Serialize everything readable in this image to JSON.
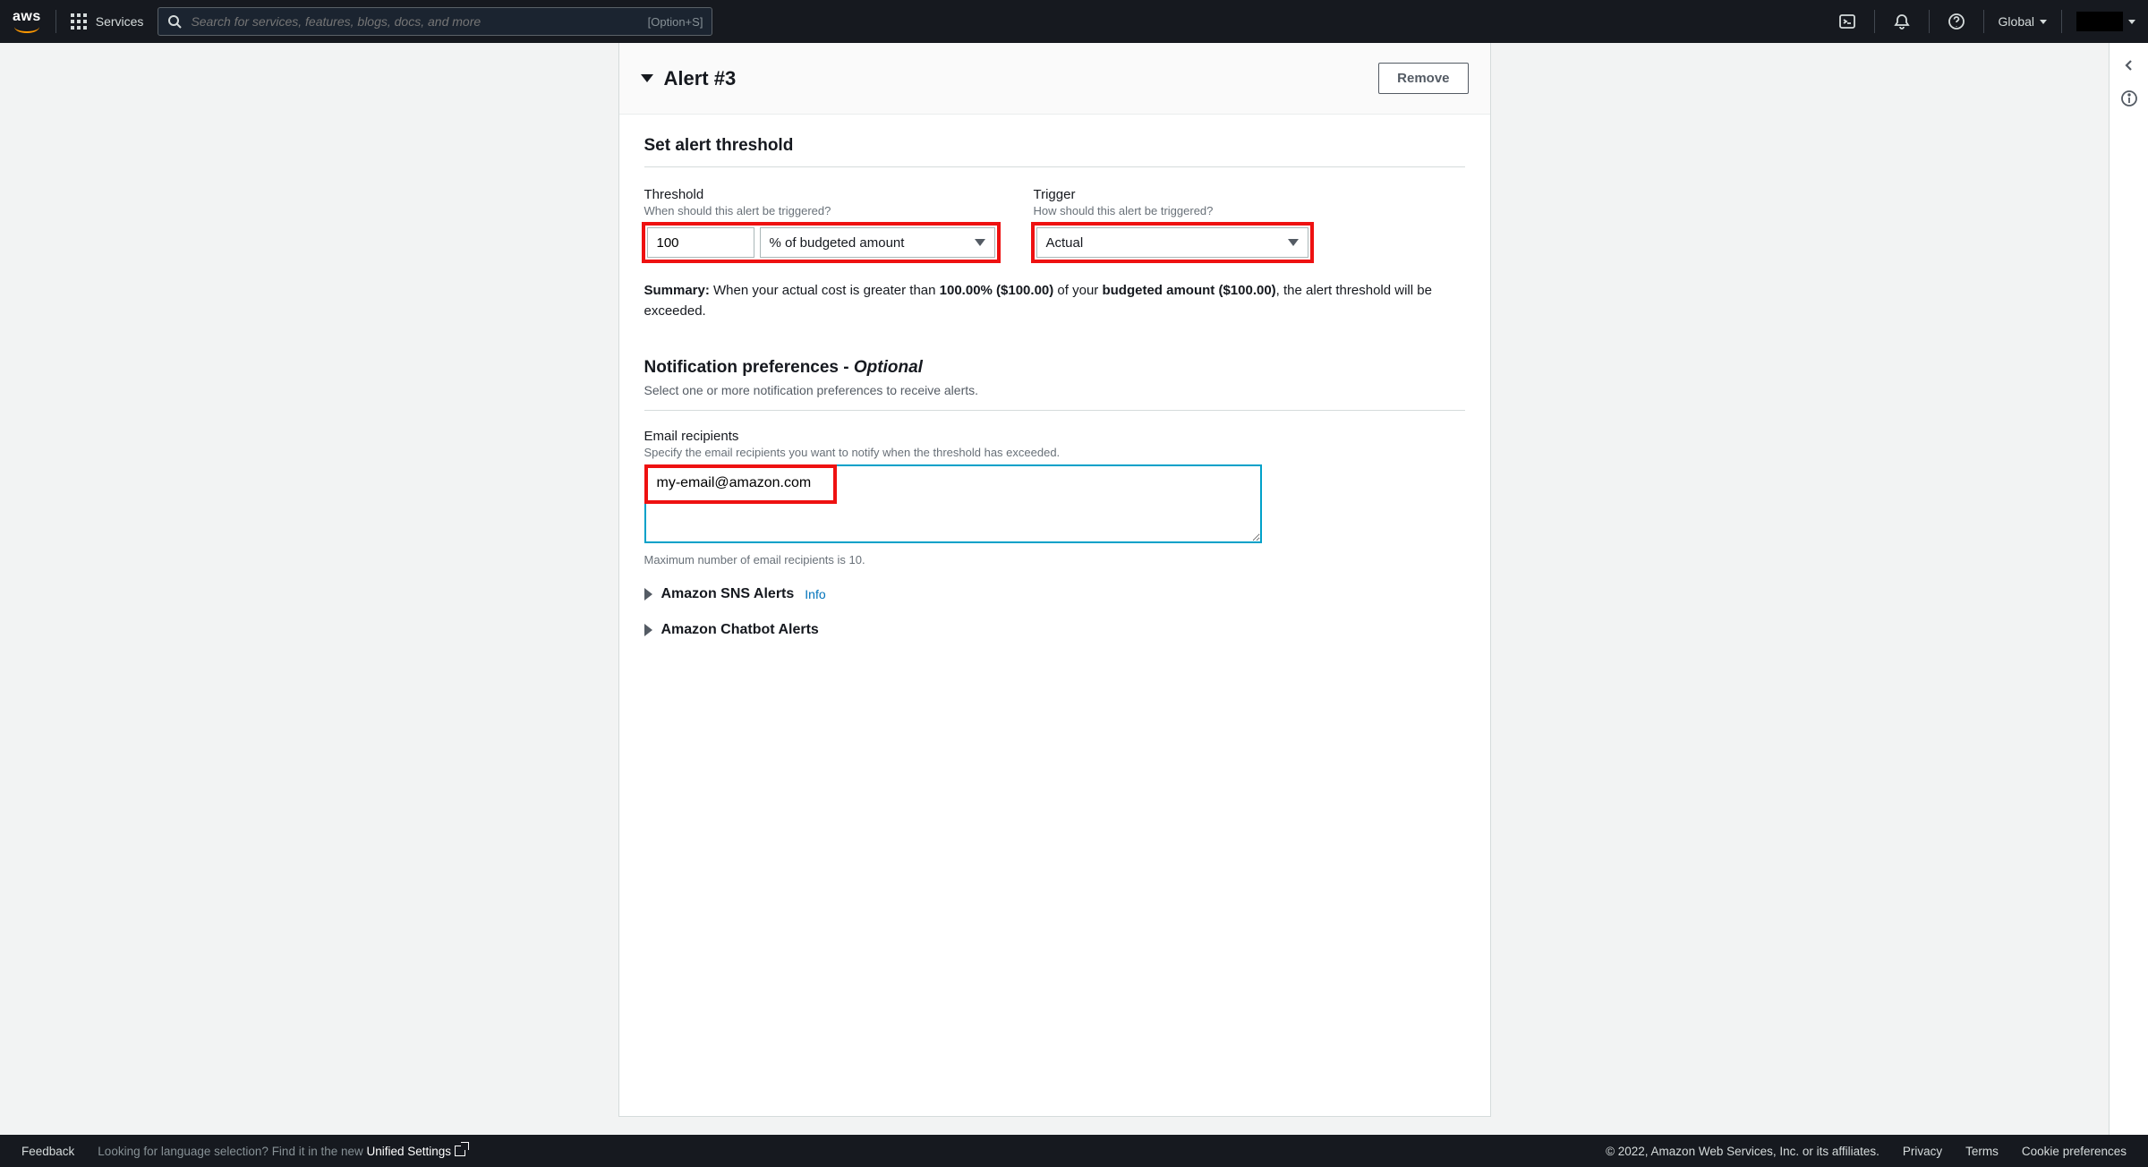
{
  "nav": {
    "services_label": "Services",
    "search_placeholder": "Search for services, features, blogs, docs, and more",
    "search_shortcut": "[Option+S]",
    "region": "Global"
  },
  "panel": {
    "title": "Alert #3",
    "remove_btn": "Remove"
  },
  "threshold_section": {
    "heading": "Set alert threshold",
    "threshold_label": "Threshold",
    "threshold_desc": "When should this alert be triggered?",
    "threshold_value": "100",
    "threshold_unit": "% of budgeted amount",
    "trigger_label": "Trigger",
    "trigger_desc": "How should this alert be triggered?",
    "trigger_value": "Actual"
  },
  "summary": {
    "prefix": "Summary:",
    "text1": " When your actual cost is greater than ",
    "pct": "100.00% ($100.00)",
    "text2": " of your ",
    "budget": "budgeted amount ($100.00)",
    "text3": ", the alert threshold will be exceeded."
  },
  "notif": {
    "heading": "Notification preferences - ",
    "optional": "Optional",
    "sub": "Select one or more notification preferences to receive alerts."
  },
  "email": {
    "label": "Email recipients",
    "desc": "Specify the email recipients you want to notify when the threshold has exceeded.",
    "value": "my-email@amazon.com",
    "note": "Maximum number of email recipients is 10."
  },
  "expanders": {
    "sns": "Amazon SNS Alerts",
    "sns_info": "Info",
    "chatbot": "Amazon Chatbot Alerts"
  },
  "footer": {
    "feedback": "Feedback",
    "lang_q": "Looking for language selection? Find it in the new ",
    "lang_link": "Unified Settings",
    "copyright": "© 2022, Amazon Web Services, Inc. or its affiliates.",
    "privacy": "Privacy",
    "terms": "Terms",
    "cookies": "Cookie preferences"
  }
}
